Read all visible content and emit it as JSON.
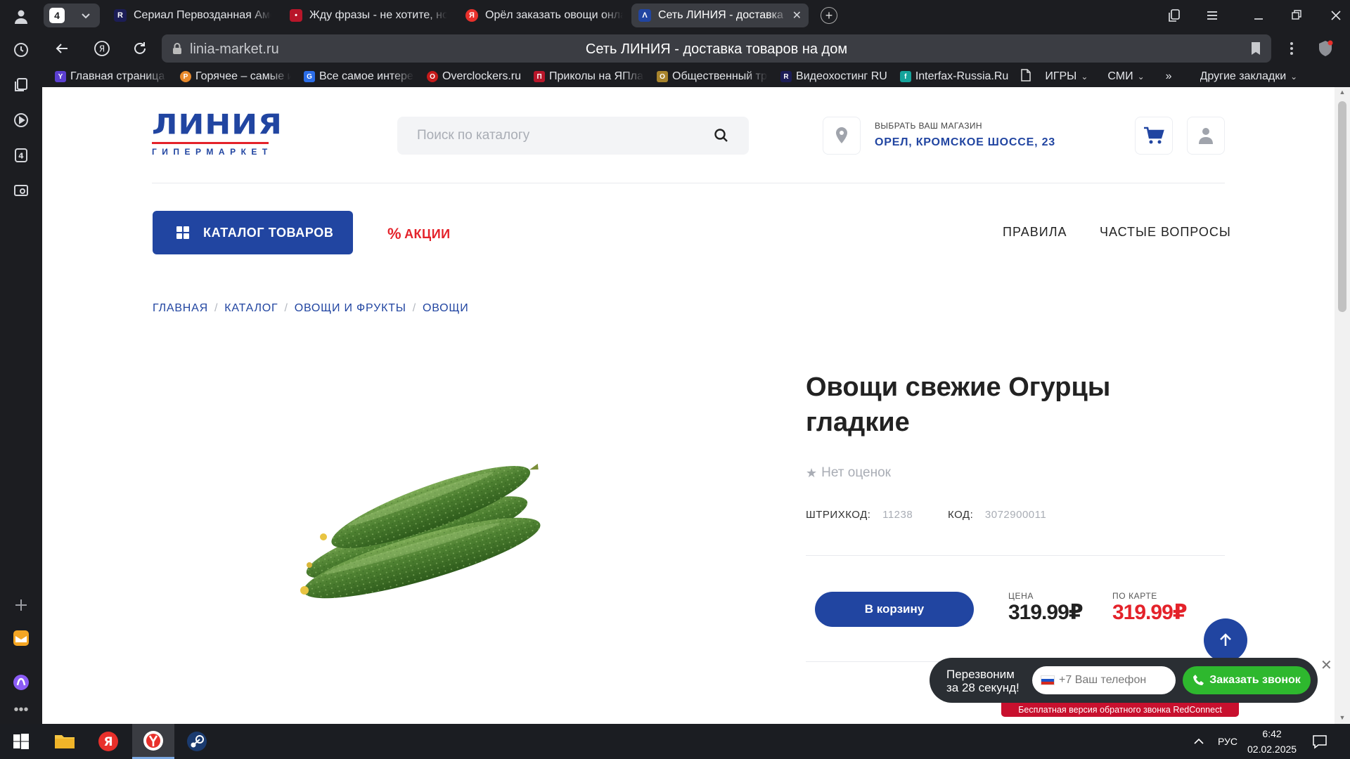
{
  "browser": {
    "tab_count": "4",
    "tabs": [
      {
        "title": "Сериал Первозданная Америка",
        "favicon": "R",
        "favicon_color": "#1c1d56"
      },
      {
        "title": "Жду фразы - не хотите, но",
        "favicon": "•",
        "favicon_color": "#b8162a"
      },
      {
        "title": "Орёл заказать овощи онлайн",
        "favicon": "Я",
        "favicon_color": "#e8302b"
      },
      {
        "title": "Сеть ЛИНИЯ - доставка",
        "favicon": "Λ",
        "favicon_color": "#2145a1"
      }
    ],
    "address": {
      "domain": "linia-market.ru",
      "page_title": "Сеть ЛИНИЯ - доставка товаров на дом"
    },
    "bookmarks": [
      {
        "label": "Главная страница",
        "favicon": "Y",
        "color": "#5b3fd1"
      },
      {
        "label": "Горячее – самые и",
        "favicon": "P",
        "color": "#e8892b"
      },
      {
        "label": "Все самое интере",
        "favicon": "G",
        "color": "#2b6de8"
      },
      {
        "label": "Overclockers.ru",
        "favicon": "O",
        "color": "#c51a1a"
      },
      {
        "label": "Приколы на ЯПла",
        "favicon": "П",
        "color": "#b8162a"
      },
      {
        "label": "Общественный тр",
        "favicon": "О",
        "color": "#a8842c"
      },
      {
        "label": "Видеохостинг RU",
        "favicon": "R",
        "color": "#1c1d56"
      },
      {
        "label": "Interfax-Russia.Ru",
        "favicon": "f",
        "color": "#15a39b"
      },
      {
        "label": "ИГРЫ",
        "favicon": "",
        "color": ""
      },
      {
        "label": "СМИ",
        "favicon": "",
        "color": ""
      }
    ],
    "bookmarks_more": "»",
    "other_bookmarks": "Другие закладки"
  },
  "site": {
    "logo_main": "ЛИНИЯ",
    "logo_sub": "ГИПЕРМАРКЕТ",
    "search_placeholder": "Поиск по каталогу",
    "store_label": "ВЫБРАТЬ ВАШ МАГАЗИН",
    "store_address": "ОРЕЛ, КРОМСКОЕ ШОССЕ, 23",
    "catalog_button": "КАТАЛОГ ТОВАРОВ",
    "promo_link": "АКЦИИ",
    "nav_rules": "ПРАВИЛА",
    "nav_faq": "ЧАСТЫЕ ВОПРОСЫ",
    "brand_blue": "#2145a1",
    "brand_red": "#e4222a"
  },
  "breadcrumb": [
    "ГЛАВНАЯ",
    "КАТАЛОГ",
    "ОВОЩИ И ФРУКТЫ",
    "ОВОЩИ"
  ],
  "product": {
    "title": "Овощи свежие Огурцы гладкие",
    "rating_text": "Нет оценок",
    "barcode_label": "ШТРИХКОД:",
    "barcode_value": "11238",
    "code_label": "КОД:",
    "code_value": "3072900011",
    "cart_button": "В корзину",
    "price_label": "ЦЕНА",
    "price_value": "319.99₽",
    "card_price_label": "ПО КАРТЕ",
    "card_price_value": "319.99₽"
  },
  "callback_widget": {
    "text_line1": "Перезвоним",
    "text_line2": "за 28 секунд!",
    "phone_placeholder": "+7 Ваш телефон",
    "button": "Заказать звонок",
    "free_notice": "Бесплатная версия обратного звонка RedConnect"
  },
  "taskbar": {
    "language": "РУС",
    "time": "6:42",
    "date": "02.02.2025"
  }
}
